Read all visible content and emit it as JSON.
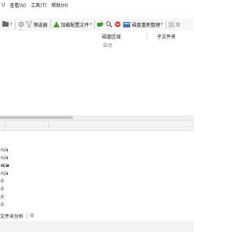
{
  "menubar": {
    "items": [
      "\\)",
      "查看(V)",
      "工具(T)",
      "帮助(H)"
    ]
  },
  "toolbar": {
    "filter_label": "筛选器",
    "load_config_label": "加载配置文件",
    "disk_scan_label": "磁盘重新整理",
    "truncated_label": "常"
  },
  "columns": {
    "disk_area": "磁盘区域",
    "disk_area_sub": "自动",
    "subfolder": "子文件夹"
  },
  "values": [
    "n/a",
    "n/a",
    "n/a",
    "n/a",
    "0",
    "0",
    "0",
    "0"
  ],
  "status": {
    "text": "文件未分析",
    "count": "0"
  }
}
